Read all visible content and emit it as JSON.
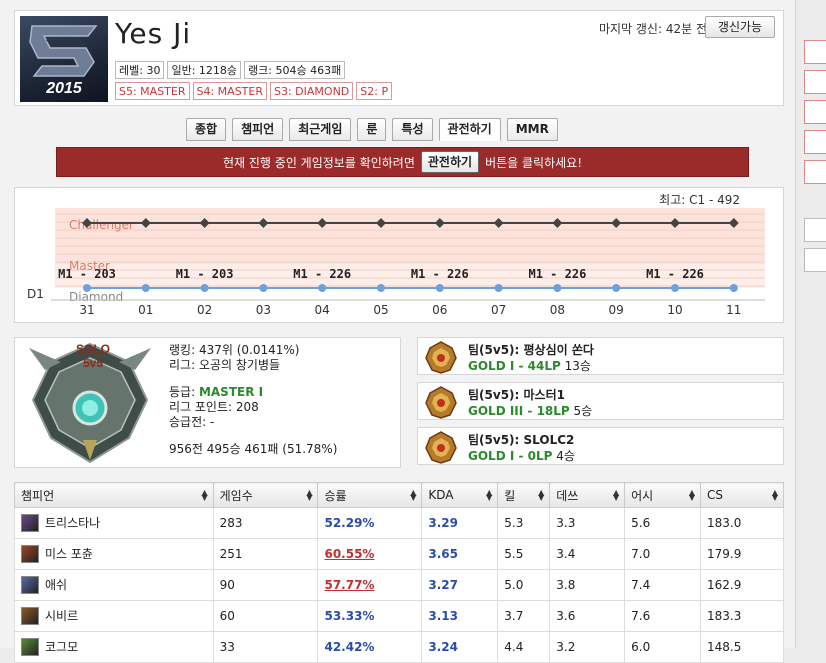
{
  "header": {
    "avatar_year": "2015",
    "summoner_name": "Yes Ji",
    "info_tags": [
      "레벨: 30",
      "일반: 1218승",
      "랭크: 504승 463패"
    ],
    "season_tags": [
      "S5: MASTER",
      "S4: MASTER",
      "S3: DIAMOND",
      "S2: P"
    ],
    "last_update": "마지막 갱신: 42분 전",
    "refresh_label": "갱신가능"
  },
  "tabs": [
    "종합",
    "챔피언",
    "최근게임",
    "룬",
    "특성",
    "관전하기",
    "MMR"
  ],
  "active_tab": "관전하기",
  "spectate": {
    "text_before": "현재 진행 중인 게임정보를 확인하려면",
    "button": "관전하기",
    "text_after": "버튼을 클릭하세요!"
  },
  "chart_data": {
    "type": "line",
    "title": "최고: C1 - 492",
    "bands": [
      "Challenger",
      "Master",
      "Diamond"
    ],
    "y_axis_label": "D1",
    "x": [
      "31",
      "01",
      "02",
      "03",
      "04",
      "05",
      "06",
      "07",
      "08",
      "09",
      "10",
      "11"
    ],
    "series": [
      {
        "name": "",
        "level": "Challenger",
        "color": "#444444",
        "values": [
          "",
          "",
          "",
          "",
          "",
          "",
          "",
          "",
          "",
          "",
          "",
          ""
        ]
      },
      {
        "name": "",
        "level": "D1",
        "color": "#6fa0dc",
        "values": [
          "M1 - 203",
          "",
          "M1 - 203",
          "",
          "M1 - 226",
          "",
          "M1 - 226",
          "",
          "M1 - 226",
          "",
          "M1 - 226",
          ""
        ]
      }
    ],
    "point_labels": [
      "M1 - 203",
      "M1 - 203",
      "M1 - 226",
      "M1 - 226",
      "M1 - 226",
      "M1 - 226"
    ]
  },
  "solo": {
    "emblem_title": "SOLO",
    "emblem_sub": "5v5",
    "ranking": "랭킹: 437위 (0.0141%)",
    "league": "리그: 오공의 창기병들",
    "tier_label": "등급:",
    "tier": "MASTER I",
    "points": "리그 포인트: 208",
    "promo": "승급전: -",
    "record": "956전 495승 461패 (51.78%)"
  },
  "teams": [
    {
      "name": "팀(5v5): 평상심이 쏜다",
      "rank": "GOLD I - 44LP",
      "wins": "13승"
    },
    {
      "name": "팀(5v5): 마스터1",
      "rank": "GOLD III - 18LP",
      "wins": "5승"
    },
    {
      "name": "팀(5v5): SLOLC2",
      "rank": "GOLD I - 0LP",
      "wins": "4승"
    }
  ],
  "table": {
    "columns": [
      "챔피언",
      "게임수",
      "승률",
      "KDA",
      "킬",
      "데쓰",
      "어시",
      "CS"
    ],
    "rows": [
      {
        "champ": "트리스타나",
        "games": "283",
        "winrate": "52.29%",
        "kda": "3.29",
        "kill": "5.3",
        "death": "3.3",
        "assist": "5.6",
        "cs": "183.0",
        "color": "#6a4a8a",
        "wr_high": false
      },
      {
        "champ": "미스 포츈",
        "games": "251",
        "winrate": "60.55%",
        "kda": "3.65",
        "kill": "5.5",
        "death": "3.4",
        "assist": "7.0",
        "cs": "179.9",
        "color": "#a0442a",
        "wr_high": true
      },
      {
        "champ": "애쉬",
        "games": "90",
        "winrate": "57.77%",
        "kda": "3.27",
        "kill": "5.0",
        "death": "3.8",
        "assist": "7.4",
        "cs": "162.9",
        "color": "#5a6aa8",
        "wr_high": true
      },
      {
        "champ": "시비르",
        "games": "60",
        "winrate": "53.33%",
        "kda": "3.13",
        "kill": "3.7",
        "death": "3.6",
        "assist": "7.6",
        "cs": "183.3",
        "color": "#8a5a2a",
        "wr_high": false
      },
      {
        "champ": "코그모",
        "games": "33",
        "winrate": "42.42%",
        "kda": "3.24",
        "kill": "4.4",
        "death": "3.2",
        "assist": "6.0",
        "cs": "148.5",
        "color": "#5a8a3a",
        "wr_high": false
      }
    ]
  }
}
